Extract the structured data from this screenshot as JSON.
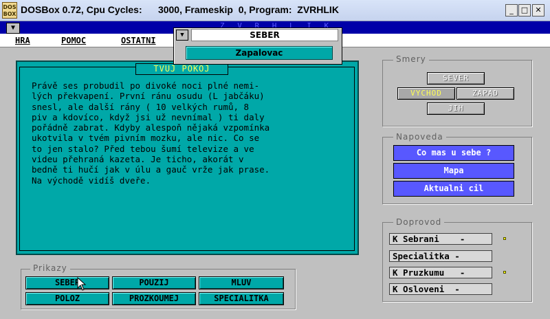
{
  "window": {
    "icon_text": "DOS BOX",
    "title": "DOSBox 0.72, Cpu Cycles:      3000, Frameskip  0, Program:  ZVRHLIK",
    "minimize": "_",
    "maximize": "□",
    "close": "✕"
  },
  "app": {
    "strip_title": "Z V R H L I K",
    "system_menu": "▼",
    "menu": [
      "HRA",
      "POMOC",
      "OSTATNI"
    ]
  },
  "dropdown": {
    "arrow": "▼",
    "label": "SEBER",
    "item": "Zapalovac"
  },
  "room": {
    "title": "TVUJ POKOJ",
    "text": "Právě ses probudil po divoké noci plné nemi-\nlých překvapení. První ránu osudu (L jabčáku)\nsnesl, ale další rány ( 10 velkých rumů, 8\npiv a kdovíco, když jsi už nevnímal ) ti daly\npořádně zabrat. Kdyby alespoň nějaká vzpomínka\nukotvila v tvém pivním mozku, ale nic. Co se\nto jen stalo? Před tebou šumí televize a ve\nvideu přehraná kazeta. Je ticho, akorát v\nbedně ti hučí jak v úlu a gauč vrže jak prase.\nNa východě vidíš dveře."
  },
  "directions": {
    "title": "Smery",
    "north": "SEVER",
    "east": "VYCHOD",
    "west": "ZAPAD",
    "south": "JIH"
  },
  "help": {
    "title": "Napoveda",
    "buttons": [
      "Co mas u sebe ?",
      "Mapa",
      "Aktualni cil"
    ]
  },
  "companion": {
    "title": "Doprovod",
    "fields": [
      "K Sebrani    -",
      "Specialitka -",
      "K Pruzkumu   -",
      "K Osloveni  -"
    ]
  },
  "commands": {
    "title": "Prikazy",
    "buttons": [
      "SEBER",
      "POUZIJ",
      "MLUV",
      "POLOZ",
      "PROZKOUMEJ",
      "SPECIALITKA"
    ]
  },
  "colors": {
    "teal": "#00a8a8",
    "blue": "#5858ff",
    "title_yellow": "#ffff55",
    "navy": "#0000a8"
  }
}
